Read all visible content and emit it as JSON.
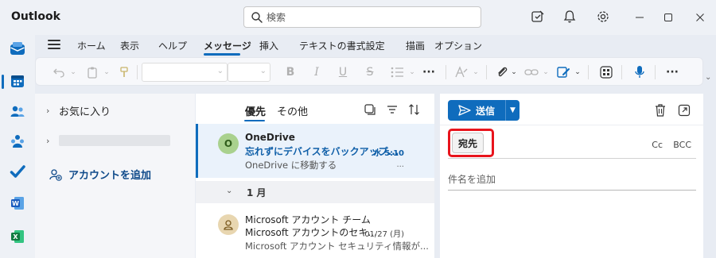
{
  "app": {
    "title": "Outlook"
  },
  "search": {
    "placeholder": "検索"
  },
  "ribbon": {
    "tabs": [
      {
        "label": "ホーム"
      },
      {
        "label": "表示"
      },
      {
        "label": "ヘルプ"
      },
      {
        "label": "メッセージ",
        "active": true
      },
      {
        "label": "挿入"
      },
      {
        "label": "テキストの書式設定"
      },
      {
        "label": "描画"
      },
      {
        "label": "オプション"
      }
    ]
  },
  "folders": {
    "favorites_label": "お気に入り",
    "add_account_label": "アカウントを追加"
  },
  "mail_list": {
    "tabs": [
      {
        "label": "優先",
        "active": true
      },
      {
        "label": "その他"
      }
    ],
    "items": [
      {
        "avatar_letter": "O",
        "sender": "OneDrive",
        "subject": "忘れずにデバイスをバックアップ...",
        "time": "水 5:10",
        "preview": "OneDrive に移動する",
        "more": "...",
        "unread": true
      },
      {
        "sender": "Microsoft アカウント チーム",
        "subject": "Microsoft アカウントのセキ...",
        "time": "01/27 (月)",
        "preview": "Microsoft アカウント セキュリティ情報が...",
        "unread": false
      }
    ],
    "group_label": "1 月"
  },
  "compose": {
    "send_label": "送信",
    "to_label": "宛先",
    "cc_label": "Cc",
    "bcc_label": "BCC",
    "subject_placeholder": "件名を追加"
  },
  "colors": {
    "accent": "#0f6cbd",
    "highlight": "#e8141c",
    "unread": "#0f5fa8"
  },
  "icons": [
    "search-icon",
    "feedback-icon",
    "bell-icon",
    "gear-icon",
    "mail-icon",
    "calendar-icon",
    "people-icon",
    "groups-icon",
    "todo-icon",
    "word-icon",
    "excel-icon",
    "hamburger-icon",
    "undo-icon",
    "paste-icon",
    "format-painter-icon",
    "bold-icon",
    "italic-icon",
    "underline-icon",
    "strikethrough-icon",
    "bullets-icon",
    "more-icon",
    "styles-icon",
    "attach-icon",
    "link-icon",
    "sign-icon",
    "apps-icon",
    "dictate-icon",
    "select-icon",
    "filter-icon",
    "sort-icon",
    "send-icon",
    "trash-icon",
    "popout-icon",
    "onedrive-avatar",
    "account-avatar"
  ]
}
